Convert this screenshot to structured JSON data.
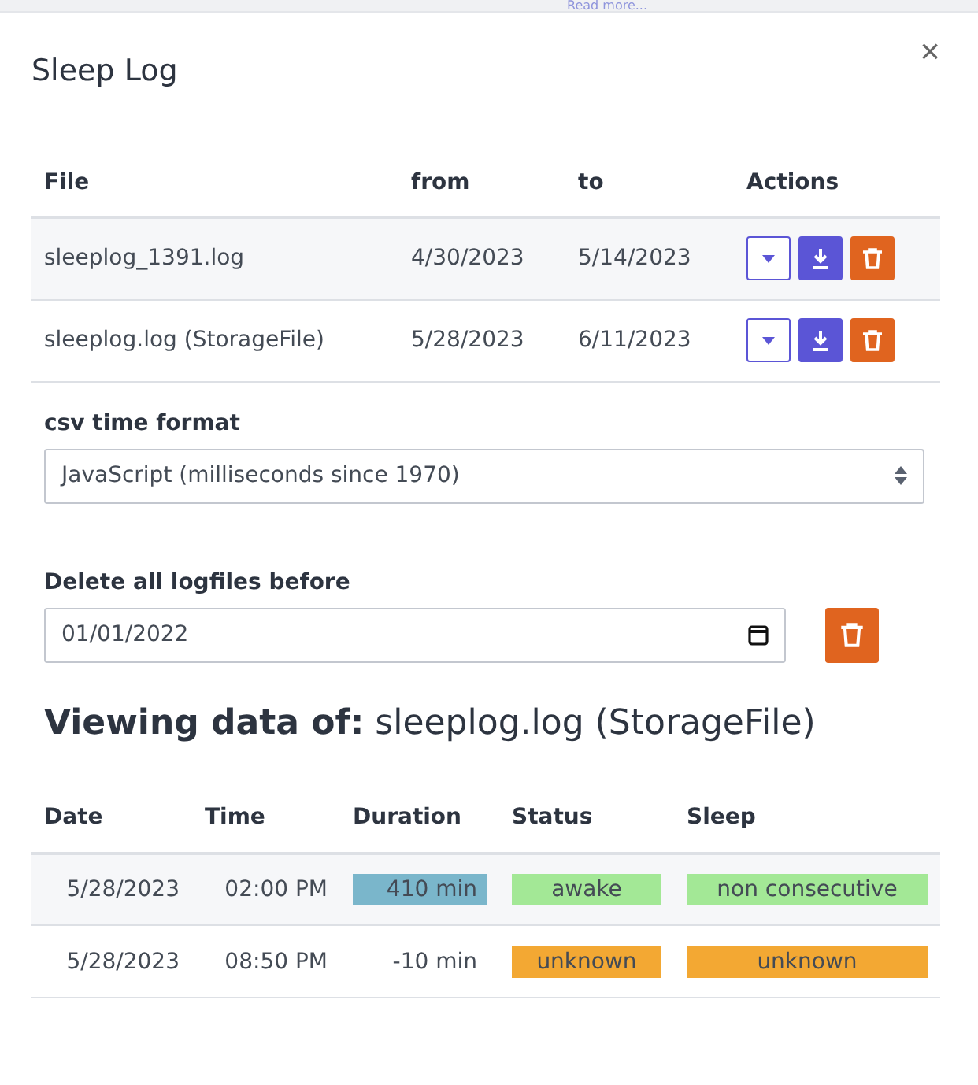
{
  "backdrop": {
    "link": "Read more..."
  },
  "dialog": {
    "title": "Sleep Log",
    "close": "×"
  },
  "files": {
    "columns": [
      "File",
      "from",
      "to",
      "Actions"
    ],
    "rows": [
      {
        "file": "sleeplog_1391.log",
        "from": "4/30/2023",
        "to": "5/14/2023"
      },
      {
        "file": "sleeplog.log (StorageFile)",
        "from": "5/28/2023",
        "to": "6/11/2023"
      }
    ]
  },
  "csv_format": {
    "label": "csv time format",
    "value": "JavaScript (milliseconds since 1970)"
  },
  "delete_before": {
    "label": "Delete all logfiles before",
    "value": "01/01/2022"
  },
  "viewing": {
    "heading": "**Viewing data of:** sleeplog.log (StorageFile)"
  },
  "data": {
    "columns": [
      "Date",
      "Time",
      "Duration",
      "Status",
      "Sleep"
    ],
    "rows": [
      {
        "date": "5/28/2023",
        "time": "02:00 PM",
        "duration": "410 min",
        "highlighted": true,
        "status": {
          "text": "awake",
          "color": "#a3e896"
        },
        "sleep": {
          "text": "non consecutive",
          "color": "#a3e896"
        }
      },
      {
        "date": "5/28/2023",
        "time": "08:50 PM",
        "duration": "-10 min",
        "highlighted": false,
        "status": {
          "text": "unknown",
          "color": "#f3a833"
        },
        "sleep": {
          "text": "unknown",
          "color": "#f3a833"
        }
      }
    ]
  }
}
